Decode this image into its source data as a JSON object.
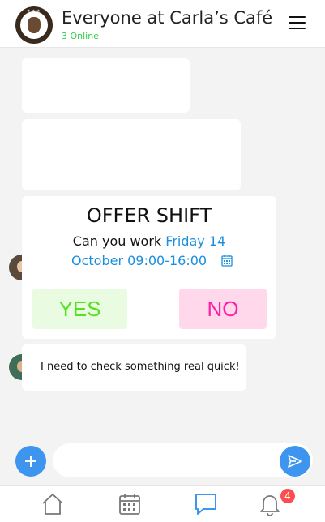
{
  "header": {
    "title": "Everyone at Carla’s Café",
    "online": "3 Online"
  },
  "offer": {
    "title": "OFFER SHIFT",
    "question_prefix": "Can you work ",
    "date_part1": "Friday 14",
    "date_part2": "October 09:00-16:00",
    "yes_label": "YES",
    "no_label": "NO"
  },
  "messages": [
    {
      "text": "I need to check something real quick!"
    }
  ],
  "nav": {
    "items": [
      "home-icon",
      "calendar-icon",
      "chat-icon",
      "bell-icon"
    ],
    "active": "chat-icon",
    "badge": "4"
  },
  "colors": {
    "accent": "#3d95ef",
    "online": "#2fcf46",
    "yes_text": "#55e21e",
    "yes_bg": "#e9fbe1",
    "no_text": "#ff1fa5",
    "no_bg": "#ffd8ec",
    "highlight": "#1a8fe0",
    "badge": "#ff4d4d"
  }
}
